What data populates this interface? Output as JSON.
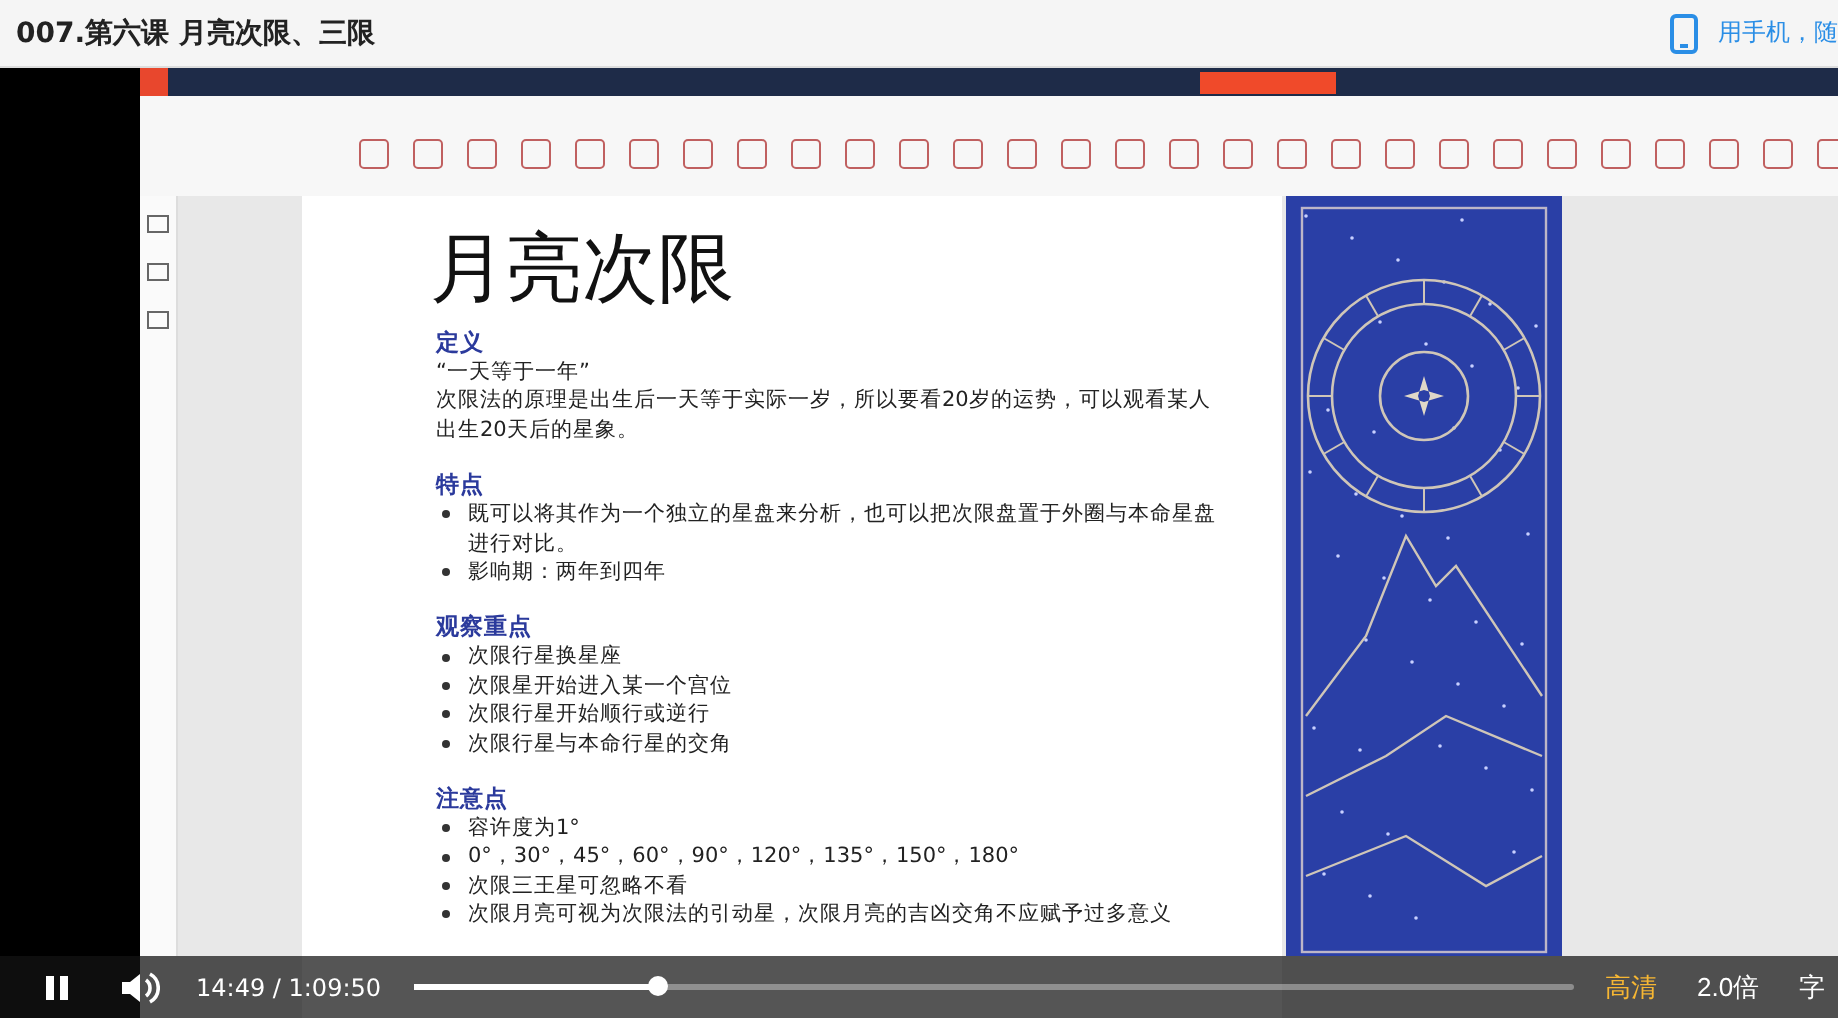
{
  "header": {
    "title": "007.第六课 月亮次限、三限",
    "mobile_link": "用手机，随"
  },
  "slide": {
    "title": "月亮次限",
    "sections": [
      {
        "heading": "定义",
        "items": [
          {
            "kind": "plain",
            "text": "“一天等于一年”"
          },
          {
            "kind": "plain",
            "text": "次限法的原理是出生后一天等于实际一岁，所以要看20岁的运势，可以观看某人出生20天后的星象。"
          }
        ]
      },
      {
        "heading": "特点",
        "items": [
          {
            "kind": "bullet",
            "text": "既可以将其作为一个独立的星盘来分析，也可以把次限盘置于外圈与本命星盘进行对比。"
          },
          {
            "kind": "bullet",
            "text": "影响期：两年到四年"
          }
        ]
      },
      {
        "heading": "观察重点",
        "items": [
          {
            "kind": "bullet",
            "text": "次限行星换星座"
          },
          {
            "kind": "bullet",
            "text": "次限星开始进入某一个宫位"
          },
          {
            "kind": "bullet",
            "text": "次限行星开始顺行或逆行"
          },
          {
            "kind": "bullet",
            "text": "次限行星与本命行星的交角"
          }
        ]
      },
      {
        "heading": "注意点",
        "items": [
          {
            "kind": "bullet",
            "text": "容许度为1°"
          },
          {
            "kind": "bullet",
            "text": "0°，30°，45°，60°，90°，120°，135°，150°，180°"
          },
          {
            "kind": "bullet",
            "text": "次限三王星可忽略不看"
          },
          {
            "kind": "bullet",
            "text": "次限月亮可视为次限法的引动星，次限月亮的吉凶交角不应赋予过多意义"
          }
        ]
      }
    ]
  },
  "controls": {
    "playing": true,
    "time": "14:49 / 1:09:50",
    "progress": {
      "level": 0.212
    },
    "quality": "高清",
    "speed": "2.0倍",
    "subtitles": "字"
  }
}
